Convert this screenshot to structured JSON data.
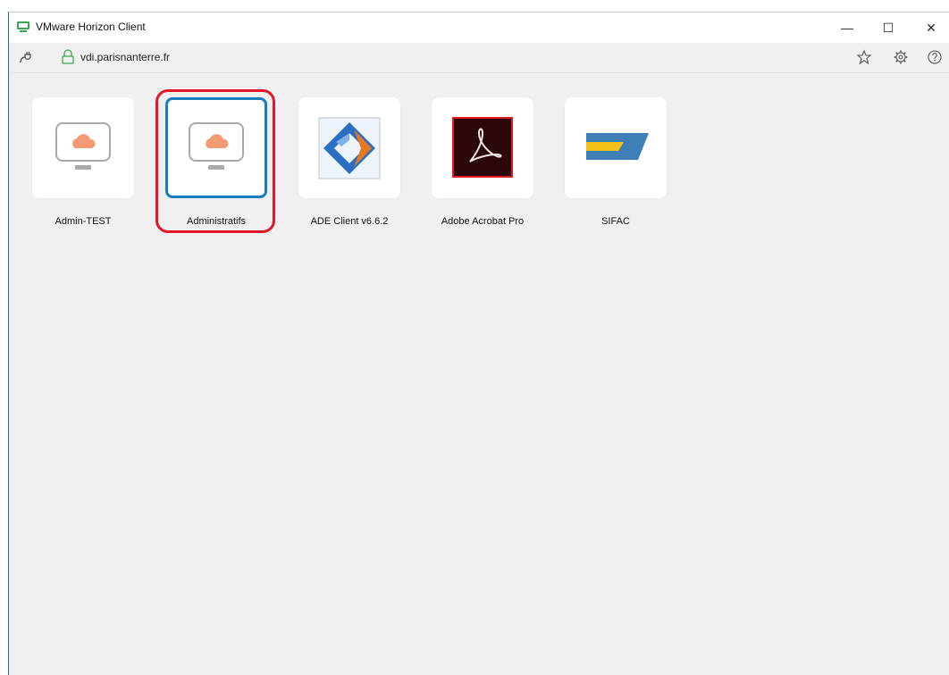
{
  "window": {
    "title": "VMware Horizon Client",
    "controls": {
      "minimize": "—",
      "maximize": "☐",
      "close": "✕"
    }
  },
  "addressbar": {
    "server": "vdi.parisnanterre.fr",
    "icons": [
      "plug-icon",
      "lock-icon",
      "star-icon",
      "gear-icon",
      "help-icon"
    ]
  },
  "apps": [
    {
      "label": "Admin-TEST",
      "icon": "desktop-cloud-icon",
      "selected": false
    },
    {
      "label": "Administratifs",
      "icon": "desktop-cloud-icon",
      "selected": true
    },
    {
      "label": "ADE Client v6.6.2",
      "icon": "ade-client-icon",
      "selected": false
    },
    {
      "label": "Adobe Acrobat Pro",
      "icon": "adobe-acrobat-icon",
      "selected": false
    },
    {
      "label": "SIFAC",
      "icon": "sifac-icon",
      "selected": false
    }
  ],
  "colors": {
    "accent": "#1a7bbf",
    "highlight": "#e3172a",
    "cloud": "#f29b73",
    "brand_green": "#3aa655"
  }
}
